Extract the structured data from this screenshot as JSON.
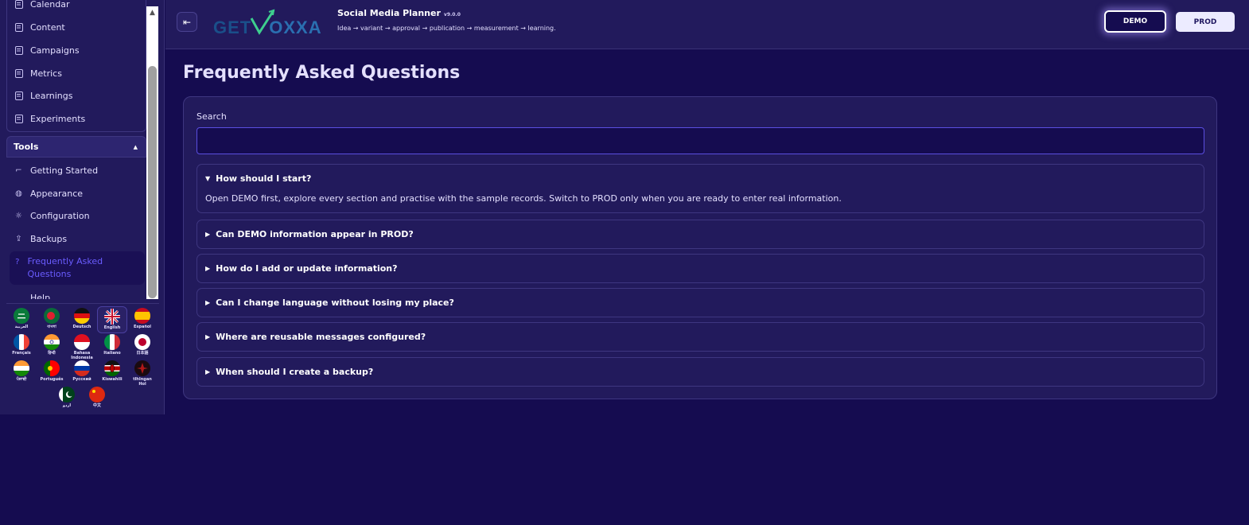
{
  "sidebar": {
    "nav_items": [
      {
        "label": "Calendar",
        "icon": "document-icon"
      },
      {
        "label": "Content",
        "icon": "document-icon"
      },
      {
        "label": "Campaigns",
        "icon": "document-icon"
      },
      {
        "label": "Metrics",
        "icon": "document-icon"
      },
      {
        "label": "Learnings",
        "icon": "document-icon"
      },
      {
        "label": "Experiments",
        "icon": "document-icon"
      }
    ],
    "tools_label": "Tools",
    "tools_items": [
      {
        "label": "Getting Started",
        "icon": "crop-icon"
      },
      {
        "label": "Appearance",
        "icon": "palette-icon"
      },
      {
        "label": "Configuration",
        "icon": "sun-icon"
      },
      {
        "label": "Backups",
        "icon": "upload-icon"
      },
      {
        "label": "Frequently Asked Questions",
        "icon": "help-circle-icon",
        "active": true
      },
      {
        "label": "Help",
        "icon": "help-icon"
      }
    ],
    "languages": [
      {
        "label": "العربية",
        "flag": "saudi-arabia"
      },
      {
        "label": "বাংলা",
        "flag": "bangladesh"
      },
      {
        "label": "Deutsch",
        "flag": "germany"
      },
      {
        "label": "English",
        "flag": "united-kingdom",
        "selected": true
      },
      {
        "label": "Español",
        "flag": "spain"
      },
      {
        "label": "Français",
        "flag": "france"
      },
      {
        "label": "हिन्दी",
        "flag": "india"
      },
      {
        "label": "Bahasa Indonesia",
        "flag": "indonesia"
      },
      {
        "label": "Italiano",
        "flag": "italy"
      },
      {
        "label": "日本語",
        "flag": "japan"
      },
      {
        "label": "ਪੰਜਾਬੀ",
        "flag": "india"
      },
      {
        "label": "Português",
        "flag": "portugal"
      },
      {
        "label": "Русский",
        "flag": "russia"
      },
      {
        "label": "Kiswahili",
        "flag": "kenya"
      },
      {
        "label": "tlhIngan Hol",
        "flag": "klingon"
      },
      {
        "label": "اردو",
        "flag": "pakistan"
      },
      {
        "label": "中文",
        "flag": "china"
      }
    ]
  },
  "header": {
    "logo_text_prefix": "GET",
    "logo_text_suffix": "OXXA",
    "app_title": "Social Media Planner",
    "version": "v9.0.0",
    "subtitle": "Idea → variant → approval → publication → measurement → learning.",
    "demo_label": "DEMO",
    "prod_label": "PROD"
  },
  "main": {
    "title": "Frequently Asked Questions",
    "search_label": "Search",
    "search_value": "",
    "faqs": [
      {
        "question": "How should I start?",
        "answer": "Open DEMO first, explore every section and practise with the sample records. Switch to PROD only when you are ready to enter real information.",
        "open": true
      },
      {
        "question": "Can DEMO information appear in PROD?",
        "open": false
      },
      {
        "question": "How do I add or update information?",
        "open": false
      },
      {
        "question": "Can I change language without losing my place?",
        "open": false
      },
      {
        "question": "Where are reusable messages configured?",
        "open": false
      },
      {
        "question": "When should I create a backup?",
        "open": false
      }
    ]
  },
  "colors": {
    "background": "#150c50",
    "panel": "#221a5c",
    "accent": "#6a5cff",
    "logo_blue": "#1a4f8a",
    "logo_green": "#3ecf8e"
  }
}
